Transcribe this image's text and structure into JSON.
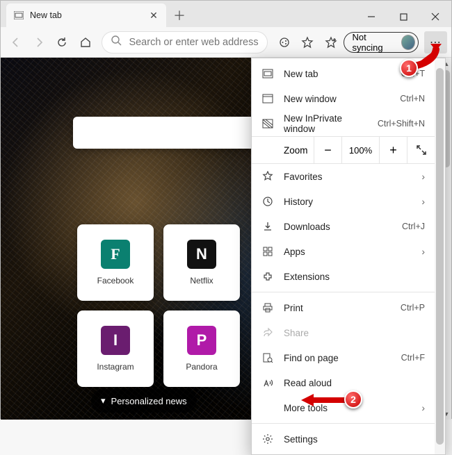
{
  "tab": {
    "title": "New tab"
  },
  "toolbar": {
    "search_placeholder": "Search or enter web address",
    "sync_label": "Not syncing"
  },
  "tiles": [
    {
      "letter": "F",
      "label": "Facebook"
    },
    {
      "letter": "N",
      "label": "Netflix"
    },
    {
      "letter": "I",
      "label": "Instagram"
    },
    {
      "letter": "P",
      "label": "Pandora"
    }
  ],
  "news_button": "Personalized news",
  "menu": {
    "new_tab": {
      "label": "New tab",
      "shortcut": "Ctrl+T"
    },
    "new_window": {
      "label": "New window",
      "shortcut": "Ctrl+N"
    },
    "new_inprivate": {
      "label": "New InPrivate window",
      "shortcut": "Ctrl+Shift+N"
    },
    "zoom_label": "Zoom",
    "zoom_value": "100%",
    "favorites": {
      "label": "Favorites"
    },
    "history": {
      "label": "History"
    },
    "downloads": {
      "label": "Downloads",
      "shortcut": "Ctrl+J"
    },
    "apps": {
      "label": "Apps"
    },
    "extensions": {
      "label": "Extensions"
    },
    "print": {
      "label": "Print",
      "shortcut": "Ctrl+P"
    },
    "share": {
      "label": "Share"
    },
    "find": {
      "label": "Find on page",
      "shortcut": "Ctrl+F"
    },
    "read_aloud": {
      "label": "Read aloud"
    },
    "more_tools": {
      "label": "More tools"
    },
    "settings": {
      "label": "Settings"
    }
  },
  "annotations": {
    "step1": "1",
    "step2": "2"
  }
}
